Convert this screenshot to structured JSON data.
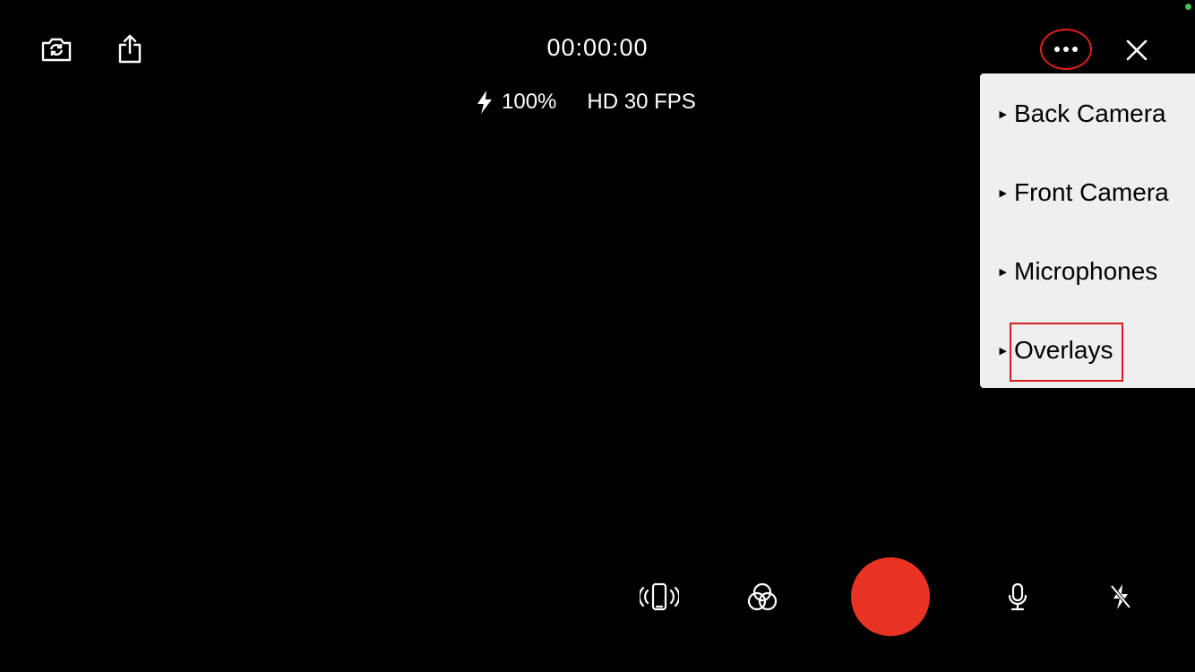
{
  "toolbar": {
    "switch_camera_icon": "camera-rotate-icon",
    "share_icon": "share-icon",
    "more_icon": "ellipsis-icon",
    "close_icon": "close-icon"
  },
  "timer": "00:00:00",
  "status": {
    "battery_icon": "bolt-icon",
    "battery": "100%",
    "format": "HD 30 FPS"
  },
  "menu": {
    "items": [
      {
        "label": "Back Camera"
      },
      {
        "label": "Front Camera"
      },
      {
        "label": "Microphones"
      },
      {
        "label": "Overlays"
      }
    ],
    "highlighted": "Overlays"
  },
  "bottom_bar": {
    "icons": [
      "vibrate-phone-icon",
      "color-filter-icon",
      "record-button",
      "microphone-icon",
      "flash-off-icon"
    ],
    "record_color": "#e83323"
  },
  "colors": {
    "background": "#000000",
    "menu_bg": "#efefef",
    "highlight": "#d81c1c",
    "indicator": "#3fbf4f"
  }
}
